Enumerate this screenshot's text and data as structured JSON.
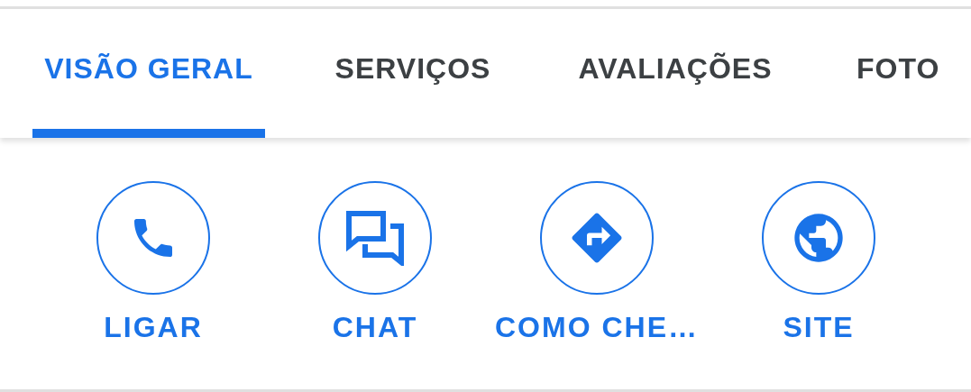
{
  "tabs": [
    {
      "label": "VISÃO GERAL",
      "selected": true
    },
    {
      "label": "SERVIÇOS",
      "selected": false
    },
    {
      "label": "AVALIAÇÕES",
      "selected": false
    },
    {
      "label": "FOTO",
      "selected": false
    }
  ],
  "actions": [
    {
      "label": "LIGAR",
      "kind": "phone"
    },
    {
      "label": "CHAT",
      "kind": "chat"
    },
    {
      "label": "COMO CHE…",
      "kind": "directions"
    },
    {
      "label": "SITE",
      "kind": "globe"
    }
  ]
}
